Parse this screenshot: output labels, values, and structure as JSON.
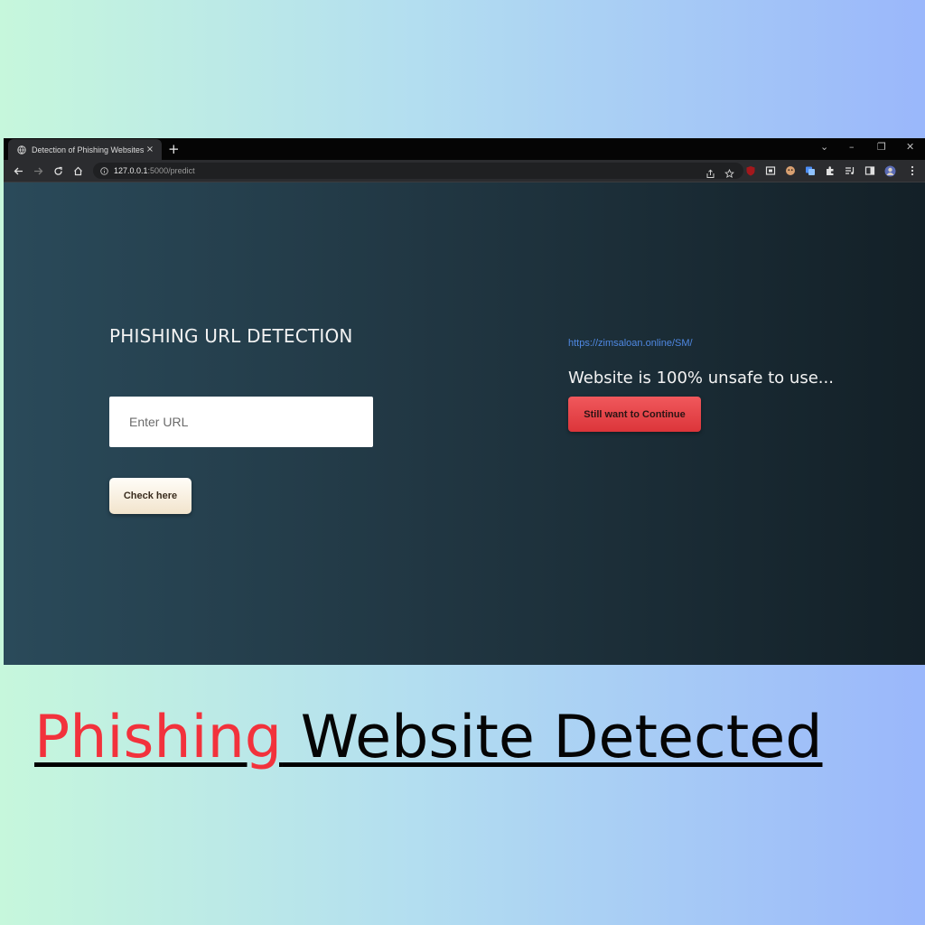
{
  "browser": {
    "tab_title": "Detection of Phishing Websites",
    "tab_close": "×",
    "new_tab": "+",
    "url_host": "127.0.0.1",
    "url_path": ":5000/predict",
    "window_controls": [
      "⌄",
      "–",
      "❐",
      "✕"
    ]
  },
  "form": {
    "heading": "PHISHING URL DETECTION",
    "input_placeholder": "Enter URL",
    "input_value": "",
    "check_label": "Check here"
  },
  "result": {
    "url": "https://zimsaloan.online/SM/",
    "message": "Website is 100% unsafe to use...",
    "continue_label": "Still want to Continue"
  },
  "caption": {
    "highlight": "Phishing",
    "rest": " Website Detected"
  },
  "colors": {
    "caption_highlight": "#f2323c",
    "result_url": "#4f88e2",
    "continue_button": "#e5434a"
  },
  "icons": [
    "globe-icon",
    "back-icon",
    "forward-icon",
    "reload-icon",
    "home-icon",
    "info-icon",
    "share-icon",
    "star-icon",
    "puzzle-icon",
    "media-icon",
    "sidepanel-icon",
    "menu-icon"
  ]
}
